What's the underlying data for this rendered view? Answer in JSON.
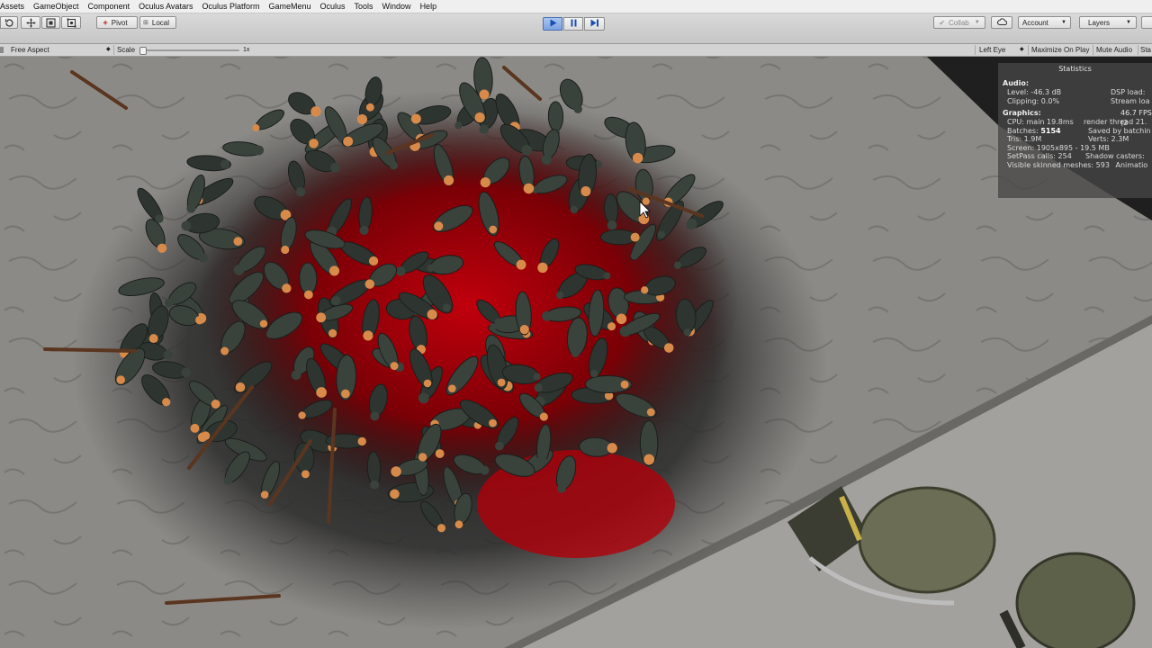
{
  "menu": {
    "items": [
      "Assets",
      "GameObject",
      "Component",
      "Oculus Avatars",
      "Oculus Platform",
      "GameMenu",
      "Oculus",
      "Tools",
      "Window",
      "Help"
    ]
  },
  "toolbar": {
    "tools": [
      "rotate-tool",
      "move-tool",
      "scale-tool",
      "rect-tool"
    ],
    "pivot_label": "Pivot",
    "local_label": "Local",
    "collab_label": "Collab",
    "account_label": "Account",
    "layers_label": "Layers",
    "play_state": "playing",
    "accent_color": "#7aa2e0"
  },
  "game_view": {
    "aspect_label": "Free Aspect",
    "scale_label": "Scale",
    "scale_value": "1x",
    "eye_label": "Left Eye",
    "maximize_label": "Maximize On Play",
    "mute_label": "Mute Audio",
    "stats_label": "Sta"
  },
  "stats": {
    "title": "Statistics",
    "audio_header": "Audio:",
    "level": "Level: -46.3 dB",
    "dsp_load": "DSP load:",
    "clipping": "Clipping: 0.0%",
    "stream_load": "Stream loa",
    "graphics_header": "Graphics:",
    "fps": "46.7 FPS (2",
    "cpu": "CPU: main 19.8ms",
    "render_thread": "render thread 21.",
    "batches_label": "Batches:",
    "batches_value": "5154",
    "saved_batching": "Saved by batchin",
    "tris": "Tris: 1.9M",
    "verts": "Verts: 2.3M",
    "screen": "Screen: 1905x895 - 19.5 MB",
    "setpass": "SetPass calls: 254",
    "shadow_casters": "Shadow casters:",
    "skinned": "Visible skinned meshes: 593",
    "animations": "Animatio"
  },
  "scene": {
    "description_colors": {
      "floor": "#8c8a86",
      "blood": "#a0000a",
      "uniform": "#2e3530",
      "skin": "#d88a4a"
    }
  }
}
